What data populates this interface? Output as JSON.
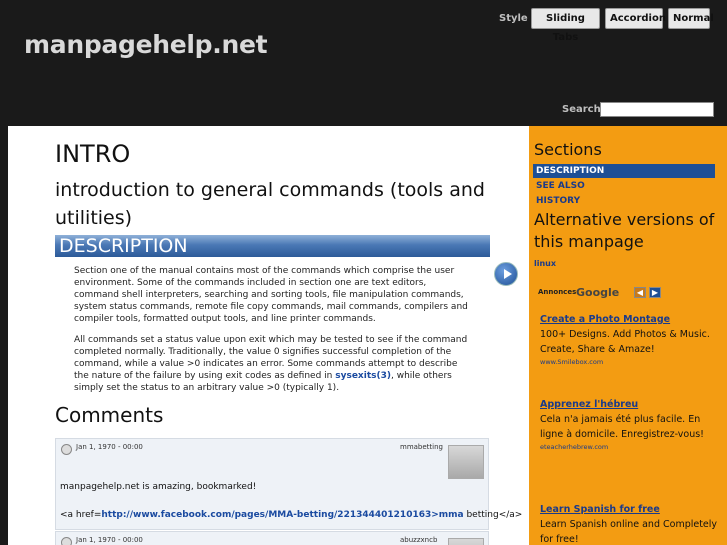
{
  "header": {
    "site_title": "manpagehelp.net",
    "style_label": "Style",
    "style_buttons": [
      "Sliding Tabs",
      "Accordion",
      "Normal"
    ],
    "search_label": "Search",
    "search_value": ""
  },
  "main": {
    "title": "INTRO",
    "subtitle": "introduction to general commands (tools and utilities)",
    "section_heading": "DESCRIPTION",
    "para1": "Section one of the manual contains most of the commands which comprise the user environment. Some of the commands included in section one are text editors, command shell interpreters, searching and sorting tools, file manipulation commands, system status commands, remote file copy commands, mail commands, compilers and compiler tools, formatted output tools, and line printer commands.",
    "para2_before": "All commands set a status value upon exit which may be tested to see if the command completed normally. Traditionally, the value 0 signifies successful completion of the command, while a value >0 indicates an error. Some commands attempt to describe the nature of the failure by using exit codes as defined in",
    "para2_link": "sysexits(3)",
    "para2_after": ", while others simply set the status to an arbitrary value >0 (typically 1).",
    "comments_heading": "Comments",
    "comments": [
      {
        "date": "Jan 1, 1970 - 00:00",
        "author": "mmabetting",
        "text": "manpagehelp.net is amazing, bookmarked!",
        "link_prefix": "<a href=",
        "link_url": "http://www.facebook.com/pages/MMA-betting/221344401210163>mma",
        "link_suffix": " betting</a>"
      },
      {
        "date": "Jan 1, 1970 - 00:00",
        "author": "abuzzxncb"
      }
    ]
  },
  "sidebar": {
    "title": "Sections",
    "items": [
      "DESCRIPTION",
      "SEE ALSO",
      "HISTORY"
    ],
    "alt_title": "Alternative versions of this manpage",
    "alt_link": "linux",
    "ads_label": "Annonces",
    "ads_brand": "Google",
    "ads": [
      {
        "title": "Create a Photo Montage",
        "body": "100+ Designs. Add Photos & Music. Create, Share & Amaze!",
        "url": "www.Smilebox.com"
      },
      {
        "title": "Apprenez l'hébreu",
        "body": "Cela n'a jamais été plus facile. En ligne à domicile. Enregistrez-vous!",
        "url": "eteacherhebrew.com"
      },
      {
        "title": "Learn Spanish for free",
        "body": "Learn Spanish online and Completely for free!"
      }
    ]
  },
  "colors": {
    "header_bg": "#1a1a1a",
    "sidebar_bg": "#f39c12",
    "accent_blue": "#1e4f95"
  }
}
